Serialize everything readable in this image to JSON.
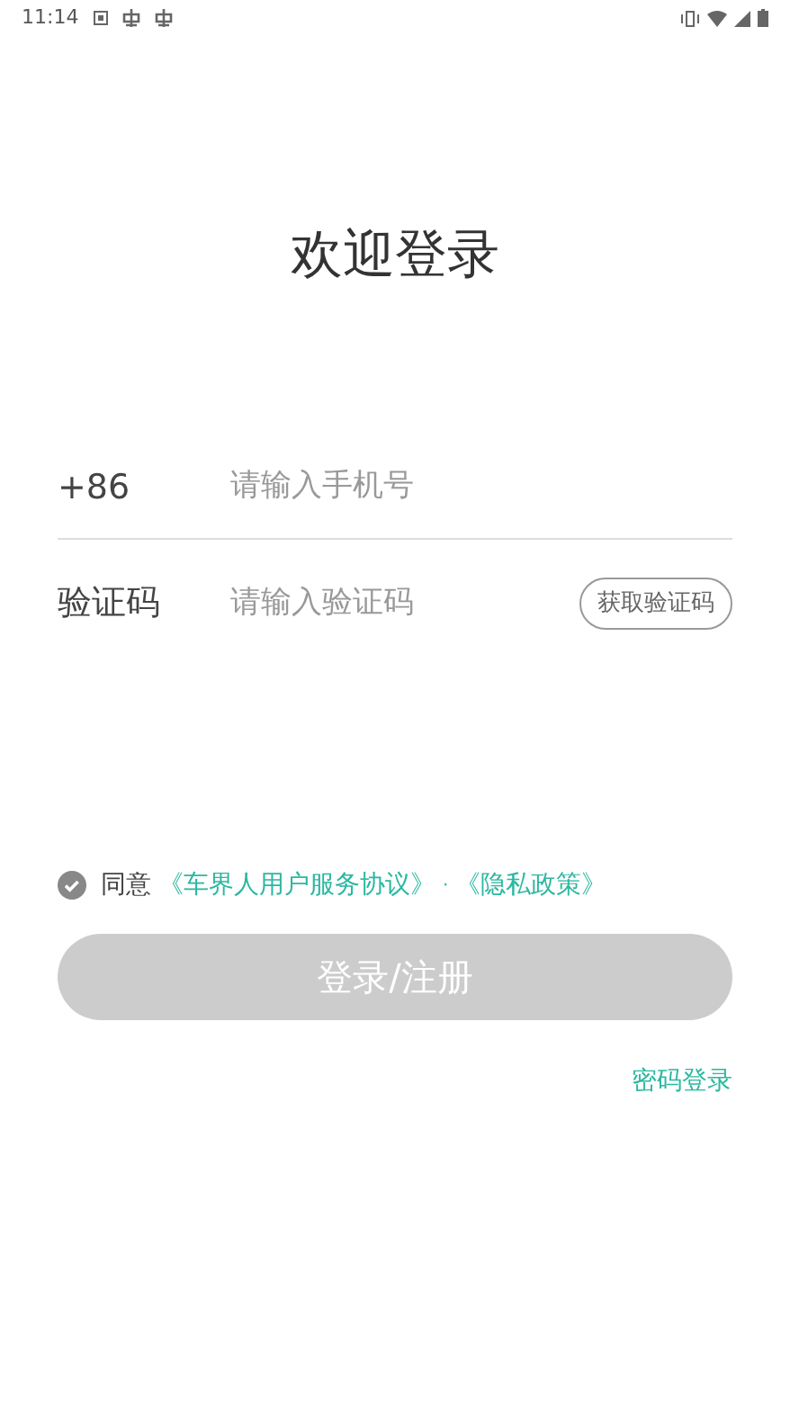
{
  "status_bar": {
    "time": "11:14"
  },
  "title": "欢迎登录",
  "phone": {
    "prefix": "+86",
    "placeholder": "请输入手机号"
  },
  "code": {
    "label": "验证码",
    "placeholder": "请输入验证码",
    "button": "获取验证码"
  },
  "agreement": {
    "checked": false,
    "prefix": "同意",
    "links": [
      "《车界人用户服务协议》",
      "《隐私政策》"
    ],
    "separator": "·"
  },
  "login_button": {
    "label": "登录/注册",
    "disabled": true
  },
  "password_login": "密码登录"
}
